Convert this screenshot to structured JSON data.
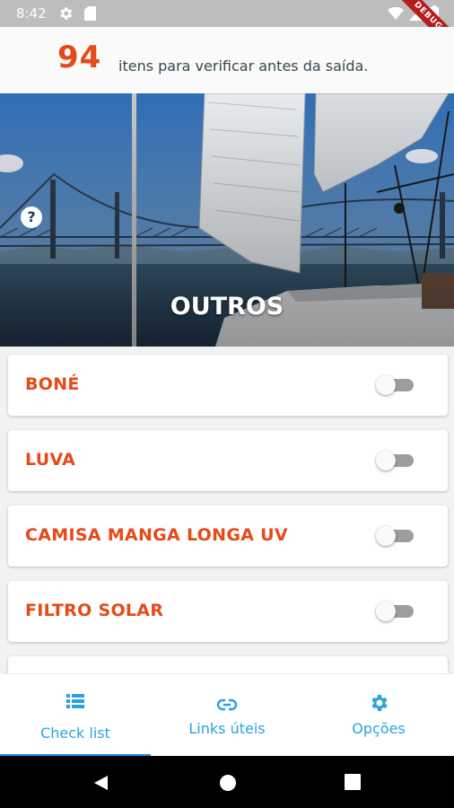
{
  "status_bar": {
    "time": "8:42",
    "debug_label": "DEBUG"
  },
  "header": {
    "count": "94",
    "text": "itens para verificar antes da saída."
  },
  "hero": {
    "title": "OUTROS",
    "help_glyph": "?"
  },
  "items": [
    {
      "label": "BONÉ",
      "checked": false
    },
    {
      "label": "LUVA",
      "checked": false
    },
    {
      "label": "CAMISA MANGA LONGA UV",
      "checked": false
    },
    {
      "label": "FILTRO SOLAR",
      "checked": false
    }
  ],
  "bottom_nav": [
    {
      "label": "Check list",
      "icon": "list-icon",
      "active": true
    },
    {
      "label": "Links úteis",
      "icon": "link-icon",
      "active": false
    },
    {
      "label": "Opções",
      "icon": "gear-icon",
      "active": false
    }
  ],
  "colors": {
    "accent": "#e64a19",
    "nav": "#29a3e0",
    "active_underline": "#1e88e5"
  }
}
